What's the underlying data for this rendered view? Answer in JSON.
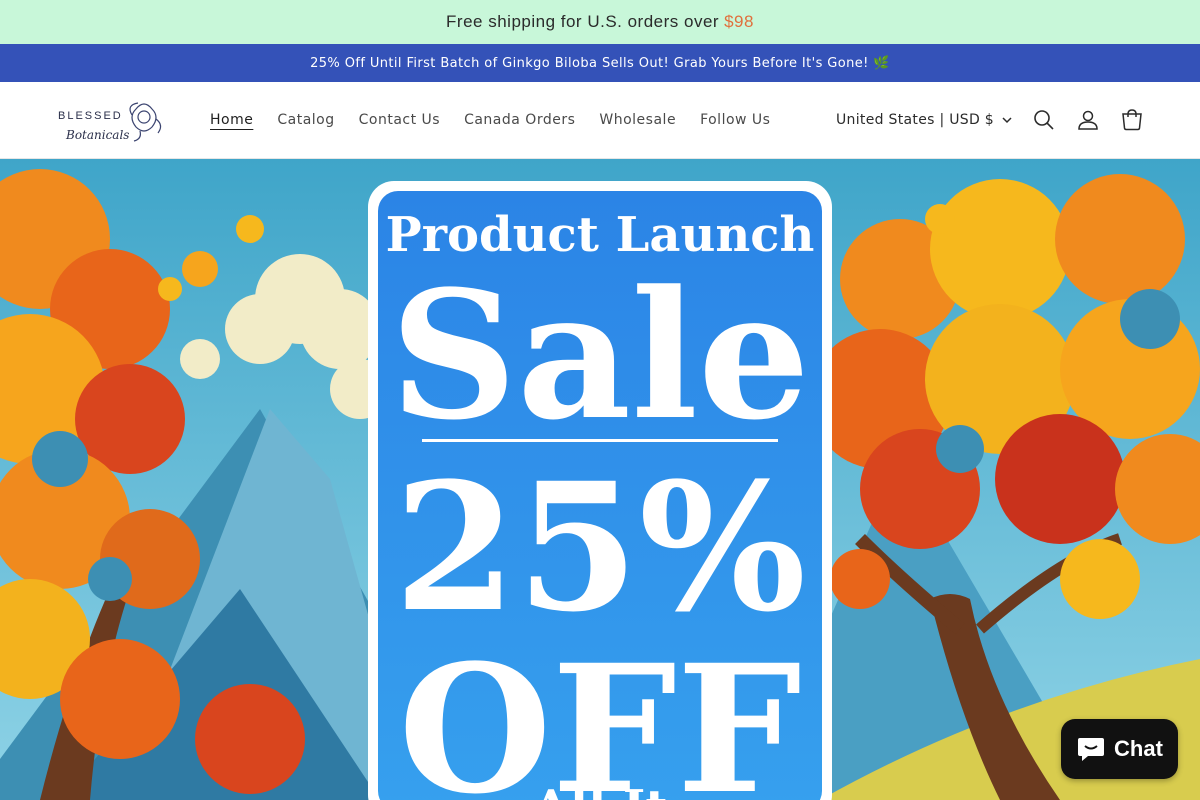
{
  "topbar": {
    "text": "Free shipping for U.S. orders over",
    "price": "$98"
  },
  "announcement": {
    "text": "25% Off Until First Batch of Ginkgo Biloba Sells Out! Grab Yours Before It's Gone! 🌿"
  },
  "header": {
    "logo_line1": "BLESSED",
    "logo_line2": "Botanicals",
    "nav": [
      "Home",
      "Catalog",
      "Contact Us",
      "Canada Orders",
      "Wholesale",
      "Follow Us"
    ],
    "country_selector": "United States | USD $",
    "icons": [
      "search-icon",
      "account-icon",
      "cart-icon"
    ]
  },
  "hero": {
    "line1": "Product Launch",
    "line2": "Sale",
    "line3": "25%",
    "line4": "OFF",
    "line5": "All It"
  },
  "chat": {
    "label": "Chat"
  },
  "colors": {
    "topbar_bg": "#c8f7d9",
    "announcement_bg": "#3452b8",
    "price_accent": "#e0703d",
    "hero_panel": "#2f8fe8"
  }
}
